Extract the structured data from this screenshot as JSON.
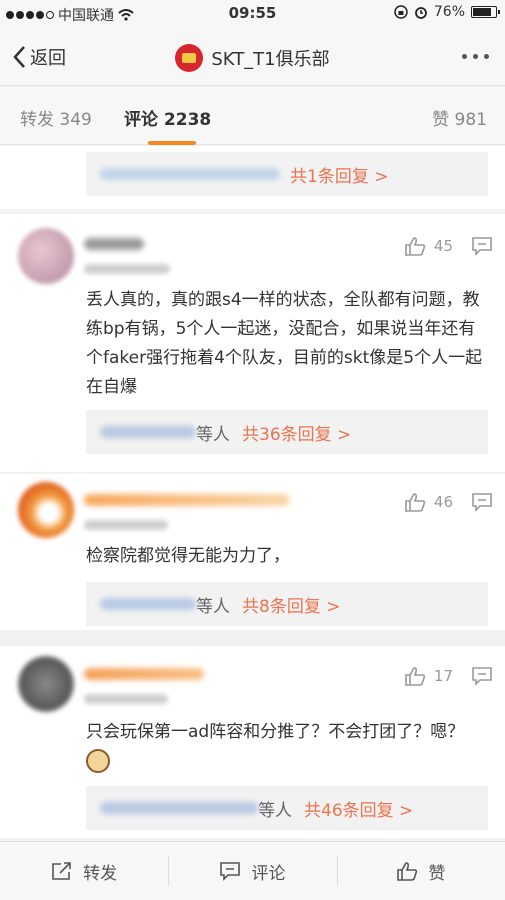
{
  "status_bar": {
    "carrier": "中国联通",
    "time": "09:55",
    "battery": "76%",
    "battery_level": 0.76
  },
  "nav": {
    "back_label": "返回",
    "title": "SKT_T1俱乐部"
  },
  "tabs": {
    "repost": "转发 349",
    "comment": "评论 2238",
    "like": "赞 981"
  },
  "comments": [
    {
      "reply_suffix": "",
      "reply_link": "共1条回复 >"
    },
    {
      "likes": "45",
      "text": "丢人真的，真的跟s4一样的状态，全队都有问题，教练bp有锅，5个人一起迷，没配合，如果说当年还有个faker强行拖着4个队友，目前的skt像是5个人一起在自爆",
      "reply_suffix": "等人",
      "reply_link": "共36条回复 >"
    },
    {
      "likes": "46",
      "text": "检察院都觉得无能为力了，",
      "reply_suffix": "等人",
      "reply_link": "共8条回复 >"
    },
    {
      "likes": "17",
      "text": "只会玩保第一ad阵容和分推了？不会打团了？嗯？",
      "reply_suffix": "等人",
      "reply_link": "共46条回复 >"
    }
  ],
  "bottom_bar": {
    "repost": "转发",
    "comment": "评论",
    "like": "赞"
  },
  "colors": {
    "accent": "#f7861e",
    "link": "#eb7350"
  },
  "icons": [
    "back-chevron-icon",
    "more-icon",
    "thumbs-up-icon",
    "reply-comment-icon",
    "share-icon",
    "comment-icon",
    "emoji-cat-icon"
  ]
}
